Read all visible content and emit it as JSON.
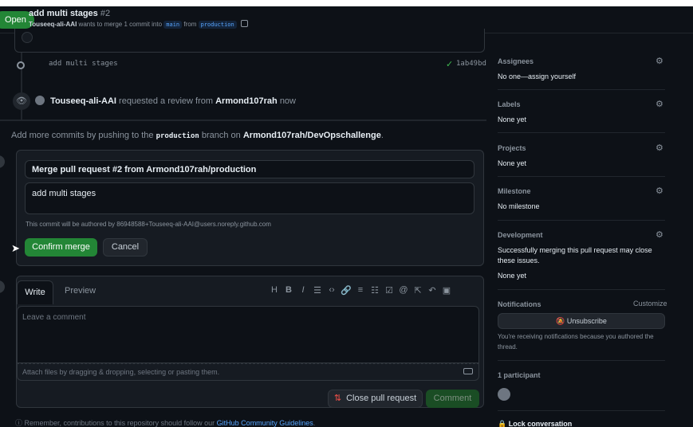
{
  "header": {
    "status": "Open",
    "title": "add multi stages",
    "number": "#2",
    "author": "Touseeq-ali-AAI",
    "merge_text": "wants to merge 1 commit into",
    "base_branch": "main",
    "from_text": "from",
    "head_branch": "production"
  },
  "timeline": {
    "commit_message": "add multi stages",
    "commit_check": "✓",
    "commit_sha": "1ab49bd",
    "review_actor": "Touseeq-ali-AAI",
    "review_text": "requested a review from",
    "review_target": "Armond107rah",
    "review_time": "now"
  },
  "add_commits": {
    "prefix": "Add more commits by pushing to the",
    "branch": "production",
    "middle": "branch on",
    "repo": "Armond107rah/DevOpschallenge",
    "suffix": "."
  },
  "merge": {
    "title_value": "Merge pull request #2 from Armond107rah/production",
    "body_value": "add multi stages",
    "author_note": "This commit will be authored by 86948588+Touseeq-ali-AAI@users.noreply.github.com",
    "confirm_label": "Confirm merge",
    "cancel_label": "Cancel"
  },
  "comment": {
    "tab_write": "Write",
    "tab_preview": "Preview",
    "toolbar_icons": [
      "H",
      "B",
      "I",
      "quote-icon",
      "code-icon",
      "link-icon",
      "bullet-list-icon",
      "numbered-list-icon",
      "task-list-icon",
      "mention-icon",
      "reference-icon",
      "reply-icon",
      "saved-reply-icon"
    ],
    "placeholder": "Leave a comment",
    "attach_text": "Attach files by dragging & dropping, selecting or pasting them.",
    "close_pr_label": "Close pull request",
    "comment_label": "Comment",
    "footer_prefix": "Remember, contributions to this repository should follow our",
    "footer_link": "GitHub Community Guidelines",
    "footer_suffix": "."
  },
  "sidebar": {
    "assignees_label": "Assignees",
    "assignees_value": "No one—assign yourself",
    "labels_label": "Labels",
    "labels_value": "None yet",
    "projects_label": "Projects",
    "projects_value": "None yet",
    "milestone_label": "Milestone",
    "milestone_value": "No milestone",
    "development_label": "Development",
    "development_text": "Successfully merging this pull request may close these issues.",
    "development_value": "None yet",
    "notifications_label": "Notifications",
    "customize_label": "Customize",
    "unsubscribe_label": "Unsubscribe",
    "notifications_text": "You're receiving notifications because you authored the thread.",
    "participants_label": "1 participant",
    "lock_label": "Lock conversation"
  },
  "colors": {
    "background": "#0d1117",
    "accent_green": "#238636",
    "link_blue": "#58a6ff",
    "danger_red": "#f85149"
  }
}
